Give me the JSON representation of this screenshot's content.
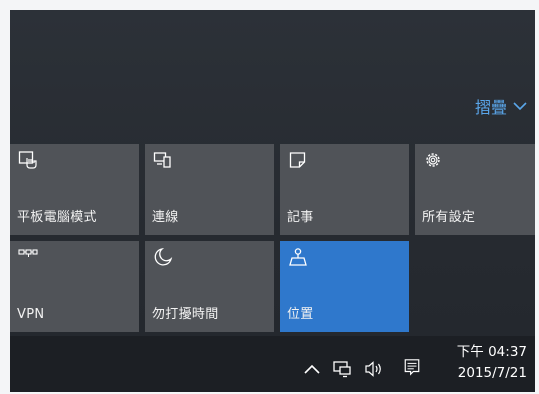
{
  "action_center": {
    "collapse_label": "摺疊",
    "collapse_icon": "chevron-down-icon",
    "accent_color": "#2f78cc",
    "tiles": [
      {
        "label": "平板電腦模式",
        "icon": "tablet-mode-icon",
        "active": false
      },
      {
        "label": "連線",
        "icon": "connect-icon",
        "active": false
      },
      {
        "label": "記事",
        "icon": "note-icon",
        "active": false
      },
      {
        "label": "所有設定",
        "icon": "gear-icon",
        "active": false
      },
      {
        "label": "VPN",
        "icon": "vpn-icon",
        "active": false
      },
      {
        "label": "勿打擾時間",
        "icon": "moon-icon",
        "active": false
      },
      {
        "label": "位置",
        "icon": "location-icon",
        "active": true
      }
    ]
  },
  "taskbar": {
    "tray_icons": [
      "chevron-up-icon",
      "network-icon",
      "volume-icon",
      "action-center-icon"
    ],
    "time": "下午 04:37",
    "date": "2015/7/21"
  }
}
